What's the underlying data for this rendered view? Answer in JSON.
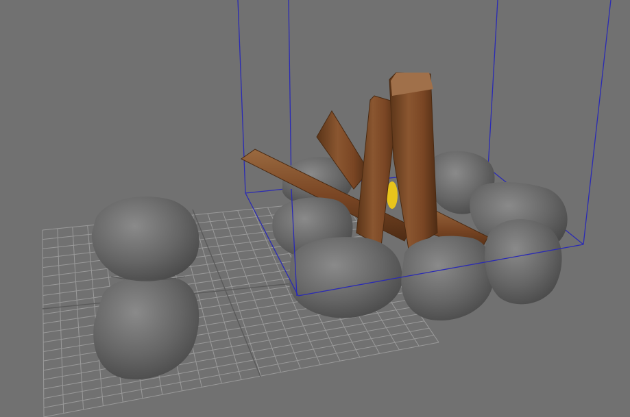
{
  "viewport": {
    "background": "#717171",
    "grid_color": "#9a9a9a",
    "grid_axis_color": "#5a5a5a",
    "bounding_box_color": "#2a2ab4",
    "stone_color": "#6e6e6e",
    "wood_color": "#7a4a2a",
    "flame_color": "#f0d020"
  },
  "scene": {
    "objects": [
      {
        "name": "campfire",
        "parts": [
          "logs",
          "stone-ring",
          "flame"
        ]
      },
      {
        "name": "stone",
        "count": 2
      }
    ]
  }
}
